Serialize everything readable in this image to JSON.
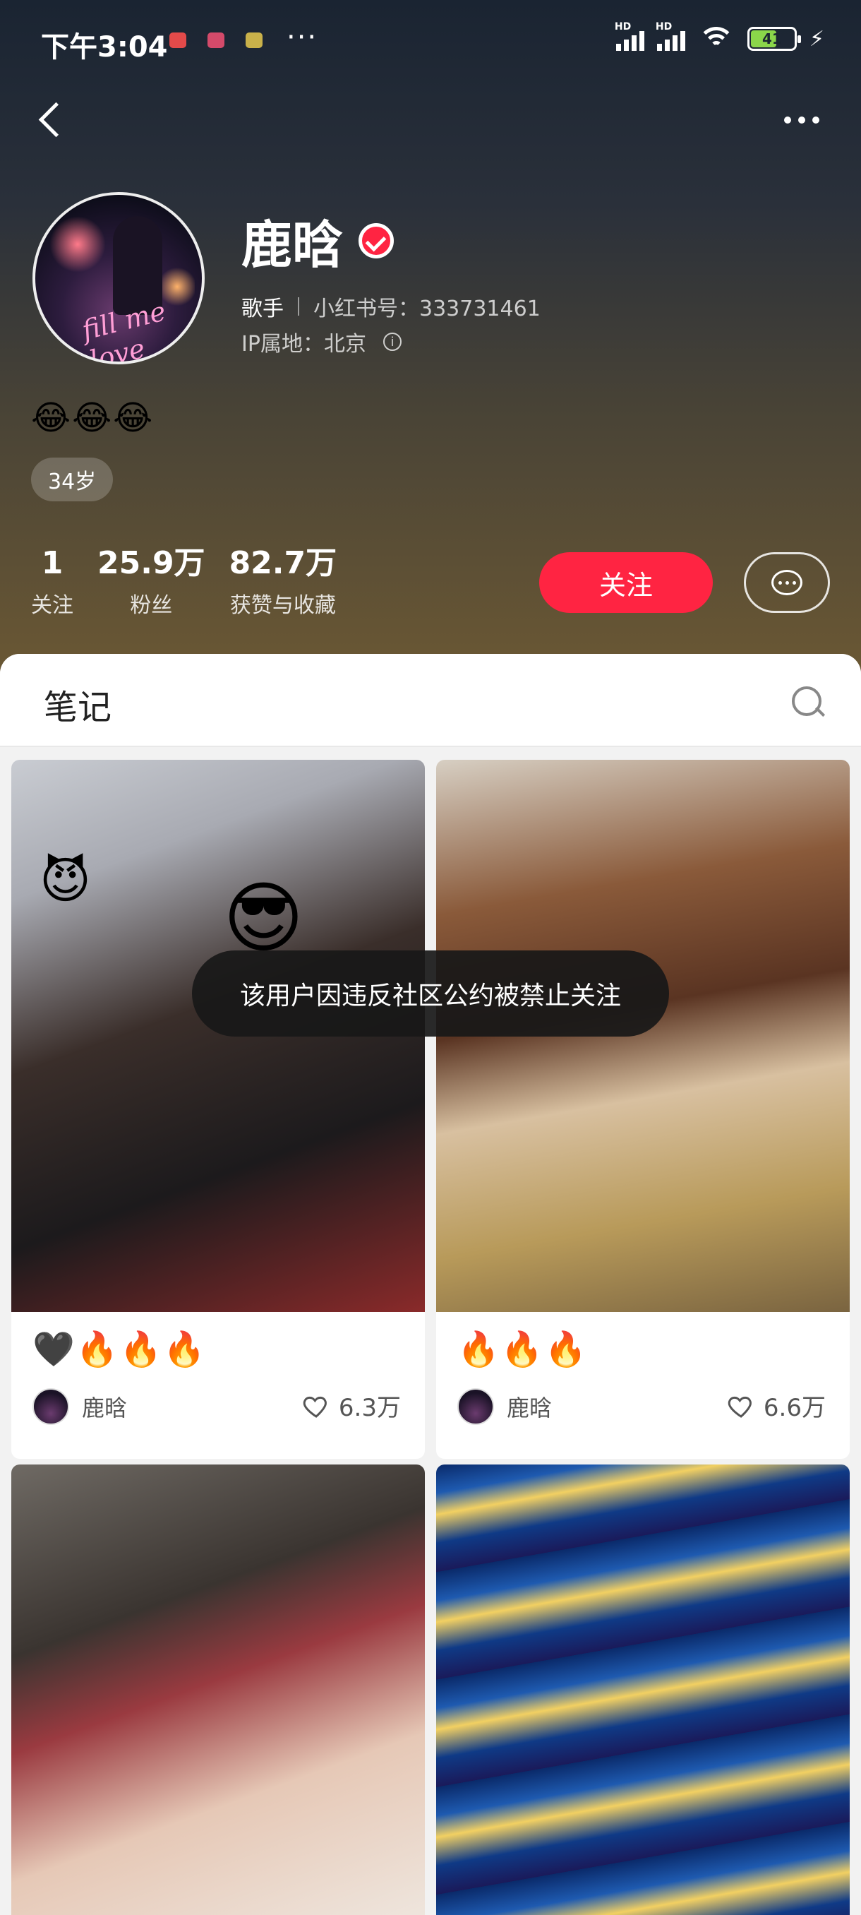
{
  "status_bar": {
    "time": "下午3:04",
    "more": "···",
    "signal_label": "HD",
    "battery_level": "41",
    "app_icon_colors": [
      "#e34a4a",
      "#d44a6a",
      "#c9b14a"
    ]
  },
  "header": {
    "back_icon": "chevron-left-icon",
    "more_icon": "more-dots-icon"
  },
  "profile": {
    "name": "鹿晗",
    "verified_icon": "verified-check-icon",
    "job": "歌手",
    "id_text": "小红书号：333731461",
    "ip_text": "IP属地：北京",
    "info_icon_glyph": "i",
    "bio": "😂😂😂",
    "age_tag": "34岁",
    "avatar_text": "fill me love"
  },
  "stats": [
    {
      "num": "1",
      "label": "关注"
    },
    {
      "num": "25.9万",
      "label": "粉丝"
    },
    {
      "num": "82.7万",
      "label": "获赞与收藏"
    }
  ],
  "actions": {
    "follow_label": "关注",
    "message_icon": "chat-bubble-icon"
  },
  "tabs": {
    "notes_label": "笔记",
    "search_icon": "search-icon"
  },
  "notes": [
    {
      "title": "🖤🔥🔥🔥",
      "author": "鹿晗",
      "likes": "6.3万",
      "sticker_top": "😈",
      "sticker_mid": "😎"
    },
    {
      "title": "🔥🔥🔥",
      "author": "鹿晗",
      "likes": "6.6万"
    },
    {
      "title": "",
      "author": "",
      "likes": ""
    },
    {
      "title": "",
      "author": "",
      "likes": ""
    }
  ],
  "toast": {
    "text": "该用户因违反社区公约被禁止关注"
  },
  "colors": {
    "accent": "#ff2442"
  }
}
